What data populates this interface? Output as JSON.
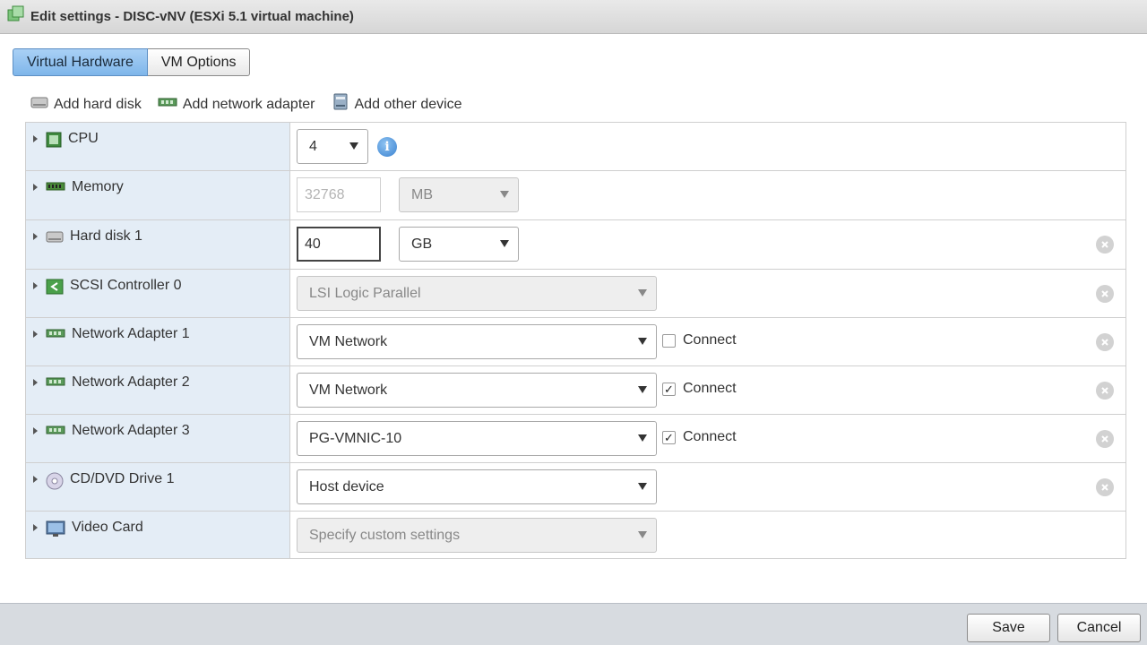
{
  "window": {
    "title": "Edit settings - DISC-vNV (ESXi 5.1 virtual machine)"
  },
  "tabs": [
    {
      "label": "Virtual Hardware",
      "active": true
    },
    {
      "label": "VM Options",
      "active": false
    }
  ],
  "toolbar": {
    "add_hard_disk": "Add hard disk",
    "add_network_adapter": "Add network adapter",
    "add_other_device": "Add other device"
  },
  "hardware": {
    "cpu": {
      "label": "CPU",
      "value": "4"
    },
    "memory": {
      "label": "Memory",
      "value": "32768",
      "unit": "MB"
    },
    "hard_disk_1": {
      "label": "Hard disk 1",
      "value": "40",
      "unit": "GB"
    },
    "scsi_controller_0": {
      "label": "SCSI Controller 0",
      "value": "LSI Logic Parallel"
    },
    "network_adapter_1": {
      "label": "Network Adapter 1",
      "value": "VM Network",
      "connect_label": "Connect",
      "connected": false
    },
    "network_adapter_2": {
      "label": "Network Adapter 2",
      "value": "VM Network",
      "connect_label": "Connect",
      "connected": true
    },
    "network_adapter_3": {
      "label": "Network Adapter 3",
      "value": "PG-VMNIC-10",
      "connect_label": "Connect",
      "connected": true
    },
    "cd_dvd_drive_1": {
      "label": "CD/DVD Drive 1",
      "value": "Host device"
    },
    "video_card": {
      "label": "Video Card",
      "value": "Specify custom settings"
    }
  },
  "footer": {
    "save_label": "Save",
    "cancel_label": "Cancel"
  },
  "icons": {
    "vm": "vm-icon",
    "cpu": "cpu-chip-icon",
    "memory": "memory-module-icon",
    "disk": "hard-disk-icon",
    "controller": "scsi-controller-icon",
    "network": "network-card-icon",
    "cd": "cd-disc-icon",
    "video": "monitor-icon",
    "info": "info-icon",
    "remove": "remove-circle-icon"
  },
  "colors": {
    "active_tab": "#8fc0ef",
    "label_column": "#e4edf6",
    "footer": "#d7dbe0"
  }
}
